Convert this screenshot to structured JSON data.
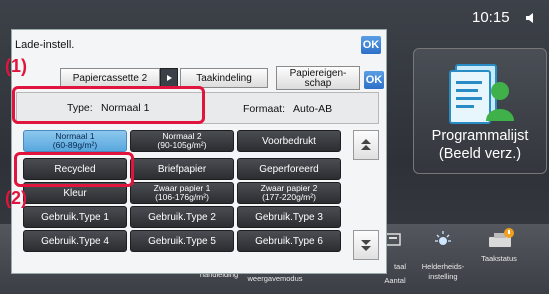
{
  "status_bar": {
    "time": "10:15",
    "icon": "speaker-icon"
  },
  "dialog": {
    "title": "Lade-instell.",
    "ok_label": "OK",
    "tabs": {
      "paper_tray": "Papiercassette 2",
      "job_assignment": "Taakindeling",
      "paper_properties": "Papiereigen-\nschap"
    },
    "type_label": "Type:",
    "type_value": "Normaal 1",
    "format_label": "Formaat:",
    "format_value": "Auto-AB",
    "paper_types": [
      {
        "label": "Normaal 1\n(60-89g/m²)",
        "selected": true
      },
      {
        "label": "Normaal 2\n(90-105g/m²)",
        "selected": false
      },
      {
        "label": "Voorbedrukt",
        "selected": false
      },
      {
        "label": "Recycled",
        "selected": false
      },
      {
        "label": "Briefpapier",
        "selected": false
      },
      {
        "label": "Geperforeerd",
        "selected": false
      },
      {
        "label": "Kleur",
        "selected": false
      },
      {
        "label": "Zwaar papier 1\n(106-176g/m²)",
        "selected": false
      },
      {
        "label": "Zwaar papier 2\n(177-220g/m²)",
        "selected": false
      },
      {
        "label": "Gebruik.Type 1",
        "selected": false
      },
      {
        "label": "Gebruik.Type 2",
        "selected": false
      },
      {
        "label": "Gebruik.Type 3",
        "selected": false
      },
      {
        "label": "Gebruik.Type 4",
        "selected": false
      },
      {
        "label": "Gebruik.Type 5",
        "selected": false
      },
      {
        "label": "Gebruik.Type 6",
        "selected": false
      }
    ]
  },
  "program_tile": {
    "label": "Programmalijst\n(Beeld verz.)"
  },
  "bottom_bar": {
    "manual": "handleiding",
    "display_mode": "weergavemodus",
    "total": "taal",
    "count": "Aantal",
    "brightness": "Helderheids-\ninstelling",
    "job_status": "Taakstatus"
  },
  "annotations": {
    "callout_1": "(1)",
    "callout_2": "(2)"
  },
  "colors": {
    "callout": "#e0143c",
    "selected": "#6cb4e6",
    "ok_button": "#3f82d6"
  }
}
